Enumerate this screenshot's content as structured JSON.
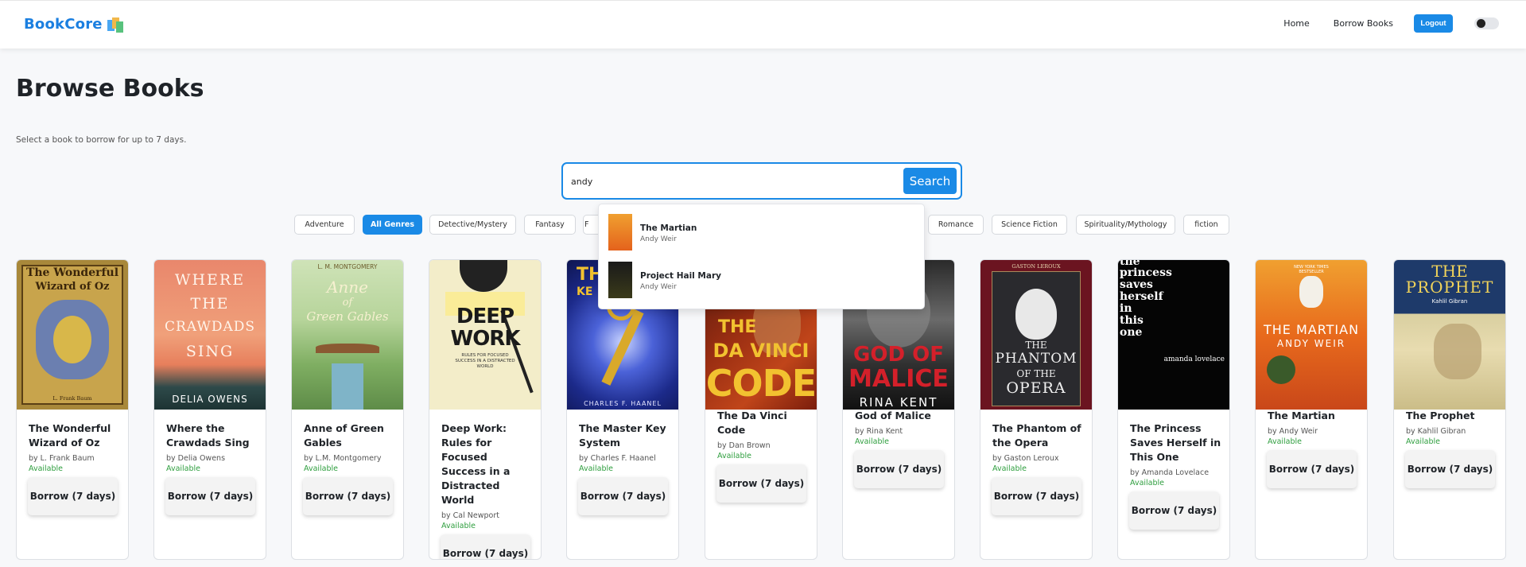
{
  "nav": {
    "brand": "BookCore",
    "home": "Home",
    "borrow_books": "Borrow Books",
    "logout": "Logout"
  },
  "header": {
    "title": "Browse Books",
    "subtitle": "Select a book to borrow for up to 7 days."
  },
  "search": {
    "value": "andy",
    "button": "Search"
  },
  "suggestions": [
    {
      "title": "The Martian",
      "author": "Andy Weir"
    },
    {
      "title": "Project Hail Mary",
      "author": "Andy Weir"
    }
  ],
  "genres": [
    "Adventure",
    "All Genres",
    "Detective/Mystery",
    "Fantasy",
    "F",
    "Romance",
    "Science Fiction",
    "Spirituality/Mythology",
    "fiction"
  ],
  "active_genre": "All Genres",
  "borrow_label": "Borrow (7 days)",
  "books": [
    {
      "title": "The Wonderful Wizard of Oz",
      "author": "by L. Frank Baum",
      "status": "Available",
      "cover_text": [
        "The Wonderful",
        "Wizard of Oz",
        "L. Frank Baum"
      ]
    },
    {
      "title": "Where the Crawdads Sing",
      "author": "by Delia Owens",
      "status": "Available",
      "cover_text": [
        "WHERE",
        "THE",
        "CRAWDADS",
        "SING",
        "DELIA OWENS"
      ]
    },
    {
      "title": "Anne of Green Gables",
      "author": "by L.M. Montgomery",
      "status": "Available",
      "cover_text": [
        "L. M. MONTGOMERY",
        "Anne",
        "of",
        "Green Gables"
      ]
    },
    {
      "title": "Deep Work: Rules for Focused Success in a Distracted World",
      "author": "by Cal Newport",
      "status": "Available",
      "cover_text": [
        "DEEP",
        "WORK",
        "RULES FOR FOCUSED SUCCESS IN A DISTRACTED WORLD"
      ]
    },
    {
      "title": "The Master Key System",
      "author": "by Charles F. Haanel",
      "status": "Available",
      "cover_text": [
        "THE",
        "KE",
        "CHARLES F. HAANEL"
      ]
    },
    {
      "title": "The Da Vinci Code",
      "author": "by Dan Brown",
      "status": "Available",
      "cover_text": [
        "THE",
        "DA VINCI",
        "CODE"
      ]
    },
    {
      "title": "God of Malice",
      "author": "by Rina Kent",
      "status": "Available",
      "cover_text": [
        "GOD OF",
        "MALICE",
        "RINA KENT"
      ]
    },
    {
      "title": "The Phantom of the Opera",
      "author": "by Gaston Leroux",
      "status": "Available",
      "cover_text": [
        "GASTON LEROUX",
        "THE",
        "PHANTOM",
        "OF THE",
        "OPERA"
      ]
    },
    {
      "title": "The Princess Saves Herself in This One",
      "author": "by Amanda Lovelace",
      "status": "Available",
      "cover_text": [
        "the",
        "princess",
        "saves",
        "herself",
        "in",
        "this",
        "one",
        "amanda lovelace"
      ]
    },
    {
      "title": "The Martian",
      "author": "by Andy Weir",
      "status": "Available",
      "cover_text": [
        "NEW YORK TIMES",
        "BESTSELLER",
        "THE MARTIAN",
        "ANDY WEIR"
      ]
    },
    {
      "title": "The Prophet",
      "author": "by Kahlil Gibran",
      "status": "Available",
      "cover_text": [
        "THE",
        "PROPHET",
        "Kahlil Gibran"
      ]
    }
  ],
  "colors": {
    "accent": "#1a8ae6",
    "available": "#2e9e3e",
    "brand": "#1b7fe0"
  }
}
